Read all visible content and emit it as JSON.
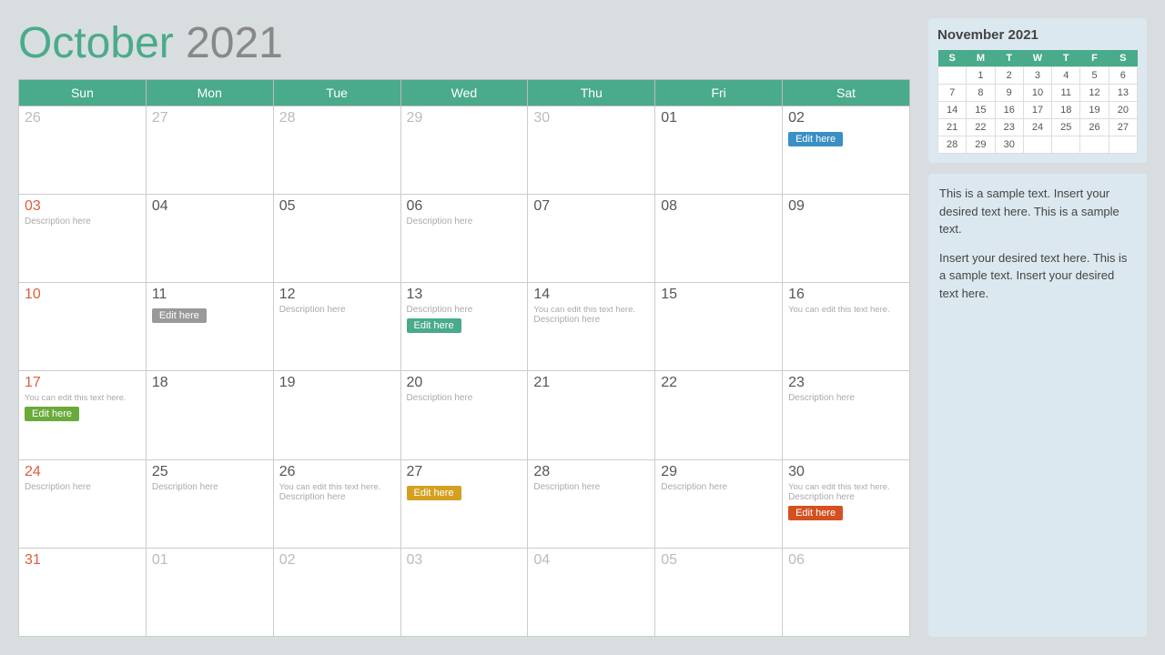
{
  "header": {
    "month": "October",
    "year": "2021"
  },
  "days_of_week": [
    "Sun",
    "Mon",
    "Tue",
    "Wed",
    "Thu",
    "Fri",
    "Sat"
  ],
  "rows": [
    [
      {
        "num": "26",
        "type": "other"
      },
      {
        "num": "27",
        "type": "other"
      },
      {
        "num": "28",
        "type": "other"
      },
      {
        "num": "29",
        "type": "other"
      },
      {
        "num": "30",
        "type": "other"
      },
      {
        "num": "01",
        "type": "current"
      },
      {
        "num": "02",
        "type": "current",
        "event": {
          "label": "Edit here",
          "color": "btn-blue"
        }
      }
    ],
    [
      {
        "num": "03",
        "type": "sunday",
        "desc": "Description here"
      },
      {
        "num": "04",
        "type": "current"
      },
      {
        "num": "05",
        "type": "current"
      },
      {
        "num": "06",
        "type": "current",
        "desc": "Description here"
      },
      {
        "num": "07",
        "type": "current"
      },
      {
        "num": "08",
        "type": "current"
      },
      {
        "num": "09",
        "type": "current"
      }
    ],
    [
      {
        "num": "10",
        "type": "sunday"
      },
      {
        "num": "11",
        "type": "current",
        "event": {
          "label": "Edit here",
          "color": "btn-gray"
        }
      },
      {
        "num": "12",
        "type": "current",
        "desc": "Description here"
      },
      {
        "num": "13",
        "type": "current",
        "desc": "Description here",
        "event": {
          "label": "Edit here",
          "color": "btn-teal"
        }
      },
      {
        "num": "14",
        "type": "current",
        "note": "You can edit this text here.",
        "desc": "Description here"
      },
      {
        "num": "15",
        "type": "current"
      },
      {
        "num": "16",
        "type": "current",
        "note": "You can edit this text here."
      }
    ],
    [
      {
        "num": "17",
        "type": "sunday",
        "note": "You can edit this text here.",
        "event": {
          "label": "Edit here",
          "color": "btn-green"
        }
      },
      {
        "num": "18",
        "type": "current"
      },
      {
        "num": "19",
        "type": "current"
      },
      {
        "num": "20",
        "type": "current",
        "desc": "Description here"
      },
      {
        "num": "21",
        "type": "current"
      },
      {
        "num": "22",
        "type": "current"
      },
      {
        "num": "23",
        "type": "current",
        "desc": "Description here"
      }
    ],
    [
      {
        "num": "24",
        "type": "sunday",
        "desc": "Description here"
      },
      {
        "num": "25",
        "type": "current",
        "desc": "Description here"
      },
      {
        "num": "26",
        "type": "current",
        "note": "You can edit this text here.",
        "desc": "Description here"
      },
      {
        "num": "27",
        "type": "current",
        "event": {
          "label": "Edit here",
          "color": "btn-yellow"
        }
      },
      {
        "num": "28",
        "type": "current",
        "desc": "Description here"
      },
      {
        "num": "29",
        "type": "current",
        "desc": "Description here"
      },
      {
        "num": "30",
        "type": "current",
        "note": "You can edit this text here.",
        "desc": "Description here",
        "event": {
          "label": "Edit here",
          "color": "btn-orange"
        }
      }
    ],
    [
      {
        "num": "31",
        "type": "sunday"
      },
      {
        "num": "01",
        "type": "other"
      },
      {
        "num": "02",
        "type": "other"
      },
      {
        "num": "03",
        "type": "other"
      },
      {
        "num": "04",
        "type": "other"
      },
      {
        "num": "05",
        "type": "other"
      },
      {
        "num": "06",
        "type": "other"
      }
    ]
  ],
  "sidebar": {
    "mini_title": "November 2021",
    "mini_headers": [
      "S",
      "M",
      "T",
      "W",
      "T",
      "F",
      "S"
    ],
    "mini_rows": [
      [
        "",
        "1",
        "2",
        "3",
        "4",
        "5",
        "6"
      ],
      [
        "7",
        "8",
        "9",
        "10",
        "11",
        "12",
        "13"
      ],
      [
        "14",
        "15",
        "16",
        "17",
        "18",
        "19",
        "20"
      ],
      [
        "21",
        "22",
        "23",
        "24",
        "25",
        "26",
        "27"
      ],
      [
        "28",
        "29",
        "30",
        "",
        "",
        "",
        ""
      ]
    ],
    "text1": "This is a sample text. Insert your desired text here. This is a sample text.",
    "text2": "Insert your desired text here. This is a sample text. Insert your desired text here."
  }
}
